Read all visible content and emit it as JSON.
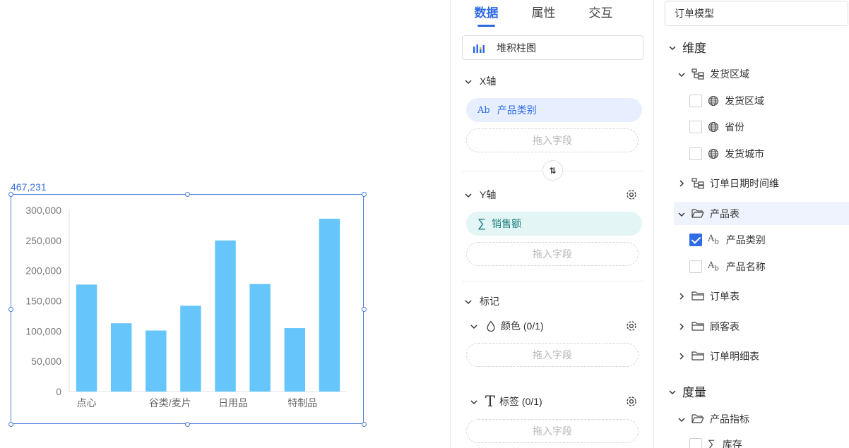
{
  "canvas": {
    "coordinate": "467,231",
    "accent": "#4a7bdc"
  },
  "chart_data": {
    "type": "bar",
    "categories": [
      "点心",
      "",
      "谷类/麦片",
      "",
      "日用品",
      "",
      "特制品",
      ""
    ],
    "values": [
      177000,
      113000,
      101000,
      142000,
      250000,
      178000,
      105000,
      286000
    ],
    "title": "",
    "xlabel": "",
    "ylabel": "",
    "ylim": [
      0,
      300000
    ],
    "yticks": [
      "0",
      "50,000",
      "100,000",
      "150,000",
      "200,000",
      "250,000",
      "300,000"
    ],
    "bar_color": "#66c6fc"
  },
  "data_panel": {
    "tabs": [
      {
        "label": "数据",
        "active": true
      },
      {
        "label": "属性",
        "active": false
      },
      {
        "label": "交互",
        "active": false
      }
    ],
    "chart_type": "堆积柱图",
    "x_axis": {
      "title": "X轴",
      "field": "产品类别",
      "field_icon": "Ab",
      "drop_hint": "拖入字段"
    },
    "swap_label": "⇅",
    "y_axis": {
      "title": "Y轴",
      "field": "销售额",
      "field_icon": "∑",
      "drop_hint": "拖入字段"
    },
    "marks": {
      "title": "标记",
      "color": {
        "label": "颜色 (0/1)",
        "drop_hint": "拖入字段"
      },
      "label": {
        "label": "标签 (0/1)",
        "drop_hint": "拖入字段"
      }
    },
    "accent": "#2e6be6"
  },
  "fields_panel": {
    "model": "订单模型",
    "dimension_title": "维度",
    "measure_title": "度量",
    "rows": [
      {
        "type": "hier",
        "label": "发货区域",
        "expanded": true
      },
      {
        "type": "geo",
        "label": "发货区域",
        "checked": false
      },
      {
        "type": "geo",
        "label": "省份",
        "checked": false
      },
      {
        "type": "geo",
        "label": "发货城市",
        "checked": false
      },
      {
        "type": "hier",
        "label": "订单日期时间维",
        "expanded": false
      },
      {
        "type": "folder",
        "label": "产品表",
        "expanded": true
      },
      {
        "type": "text",
        "label": "产品类别",
        "checked": true
      },
      {
        "type": "text",
        "label": "产品名称",
        "checked": false
      },
      {
        "type": "folder",
        "label": "订单表",
        "expanded": false
      },
      {
        "type": "folder",
        "label": "顾客表",
        "expanded": false
      },
      {
        "type": "folder",
        "label": "订单明细表",
        "expanded": false
      },
      {
        "type": "folder",
        "label": "产品指标",
        "expanded": true
      },
      {
        "type": "sum",
        "label": "库存",
        "checked": false
      }
    ]
  }
}
